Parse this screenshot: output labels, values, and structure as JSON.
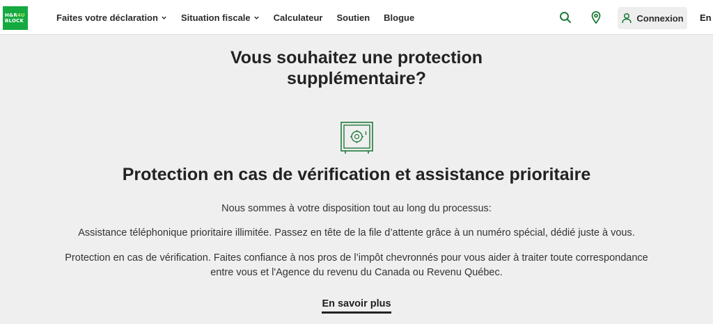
{
  "header": {
    "logo": {
      "line1": "H&R",
      "line1_accent": "4U",
      "line2": "BLOCK"
    },
    "nav": [
      {
        "label": "Faites votre déclaration",
        "has_dropdown": true
      },
      {
        "label": "Situation fiscale",
        "has_dropdown": true
      },
      {
        "label": "Calculateur",
        "has_dropdown": false
      },
      {
        "label": "Soutien",
        "has_dropdown": false
      },
      {
        "label": "Blogue",
        "has_dropdown": false
      }
    ],
    "search_icon": "search-icon",
    "location_icon": "map-pin-icon",
    "login_label": "Connexion",
    "login_icon": "user-icon",
    "language": "En"
  },
  "main": {
    "headline_line1": "Vous souhaitez une protection",
    "headline_line2": "supplémentaire?",
    "feature_icon": "safe-icon",
    "subheadline": "Protection en cas de vérification et assistance prioritaire",
    "paragraphs": [
      "Nous sommes à votre disposition tout au long du processus:",
      "Assistance téléphonique prioritaire illimitée. Passez en tête de la file d’attente grâce à un numéro spécial, dédié juste à vous.",
      "Protection en cas de vérification. Faites confiance à nos pros de l’impôt chevronnés pour vous aider à traiter toute correspondance entre vous et l'Agence du revenu du Canada ou Revenu Québec."
    ],
    "learn_more_label": "En savoir plus"
  },
  "colors": {
    "brand_green": "#14aa40",
    "icon_green": "#1f7a3a",
    "background": "#efefef"
  }
}
